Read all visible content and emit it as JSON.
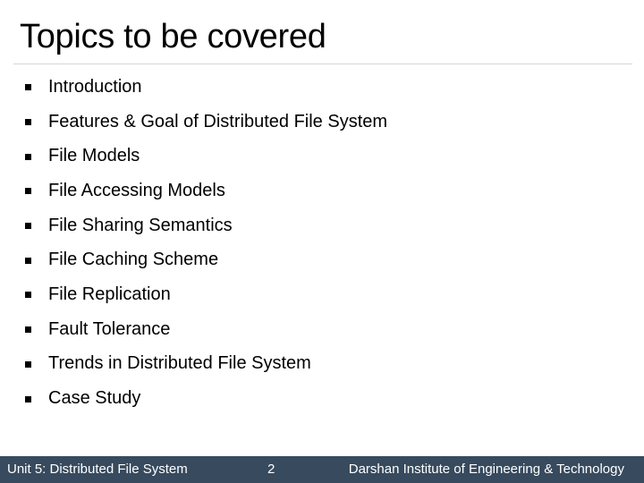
{
  "slide": {
    "title": "Topics to be covered",
    "topics": [
      "Introduction",
      "Features & Goal of Distributed File System",
      "File Models",
      "File Accessing Models",
      "File Sharing Semantics",
      "File Caching Scheme",
      "File Replication",
      "Fault Tolerance",
      "Trends in Distributed File System",
      "Case Study"
    ],
    "bullet_icon": "square-bullet-icon"
  },
  "footer": {
    "unit": "Unit 5: Distributed File System",
    "page_number": "2",
    "institute": "Darshan Institute of Engineering & Technology",
    "background_color": "#374a5e",
    "text_color": "#ffffff"
  }
}
